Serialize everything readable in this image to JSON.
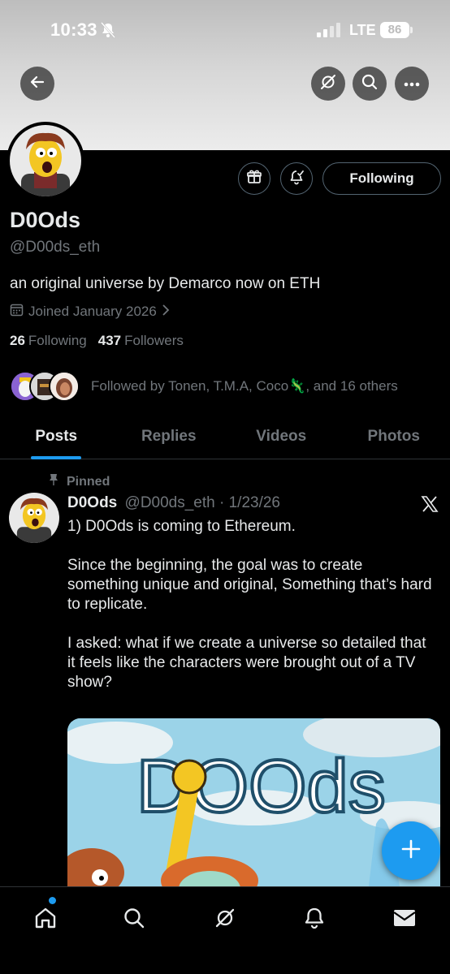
{
  "status_bar": {
    "time": "10:33",
    "network": "LTE",
    "battery": "86"
  },
  "profile": {
    "display_name": "D0Ods",
    "handle": "@D00ds_eth",
    "bio": "an original universe by Demarco now on ETH",
    "joined": "Joined January 2026",
    "following_count": "26",
    "following_label": "Following",
    "followers_count": "437",
    "followers_label": "Followers",
    "followed_by": "Followed by Tonen, T.M.A, Coco🦎, and 16 others",
    "follow_button_label": "Following"
  },
  "tabs": [
    {
      "label": "Posts",
      "active": true
    },
    {
      "label": "Replies",
      "active": false
    },
    {
      "label": "Videos",
      "active": false
    },
    {
      "label": "Photos",
      "active": false
    }
  ],
  "pinned_post": {
    "pinned_label": "Pinned",
    "author": "D0Ods",
    "handle_date": "@D00ds_eth · 1/23/26",
    "text": "1) D0Ods is coming to Ethereum.\n\nSince the beginning, the goal was to create something unique and original, Something that’s hard to replicate.\n\nI asked: what if we create a universe so detailed that it feels like the characters were brought out of a TV show?",
    "media_title": "DOOds"
  },
  "icons": {
    "back": "arrow-left-icon",
    "grok": "grok-icon",
    "search": "search-icon",
    "more": "more-horizontal-icon",
    "gift": "gift-icon",
    "notify": "bell-plus-icon",
    "x_logo": "x-logo-icon",
    "compose": "plus-icon"
  },
  "colors": {
    "accent": "#1d9bf0",
    "background": "#000000",
    "muted": "#71767b"
  }
}
